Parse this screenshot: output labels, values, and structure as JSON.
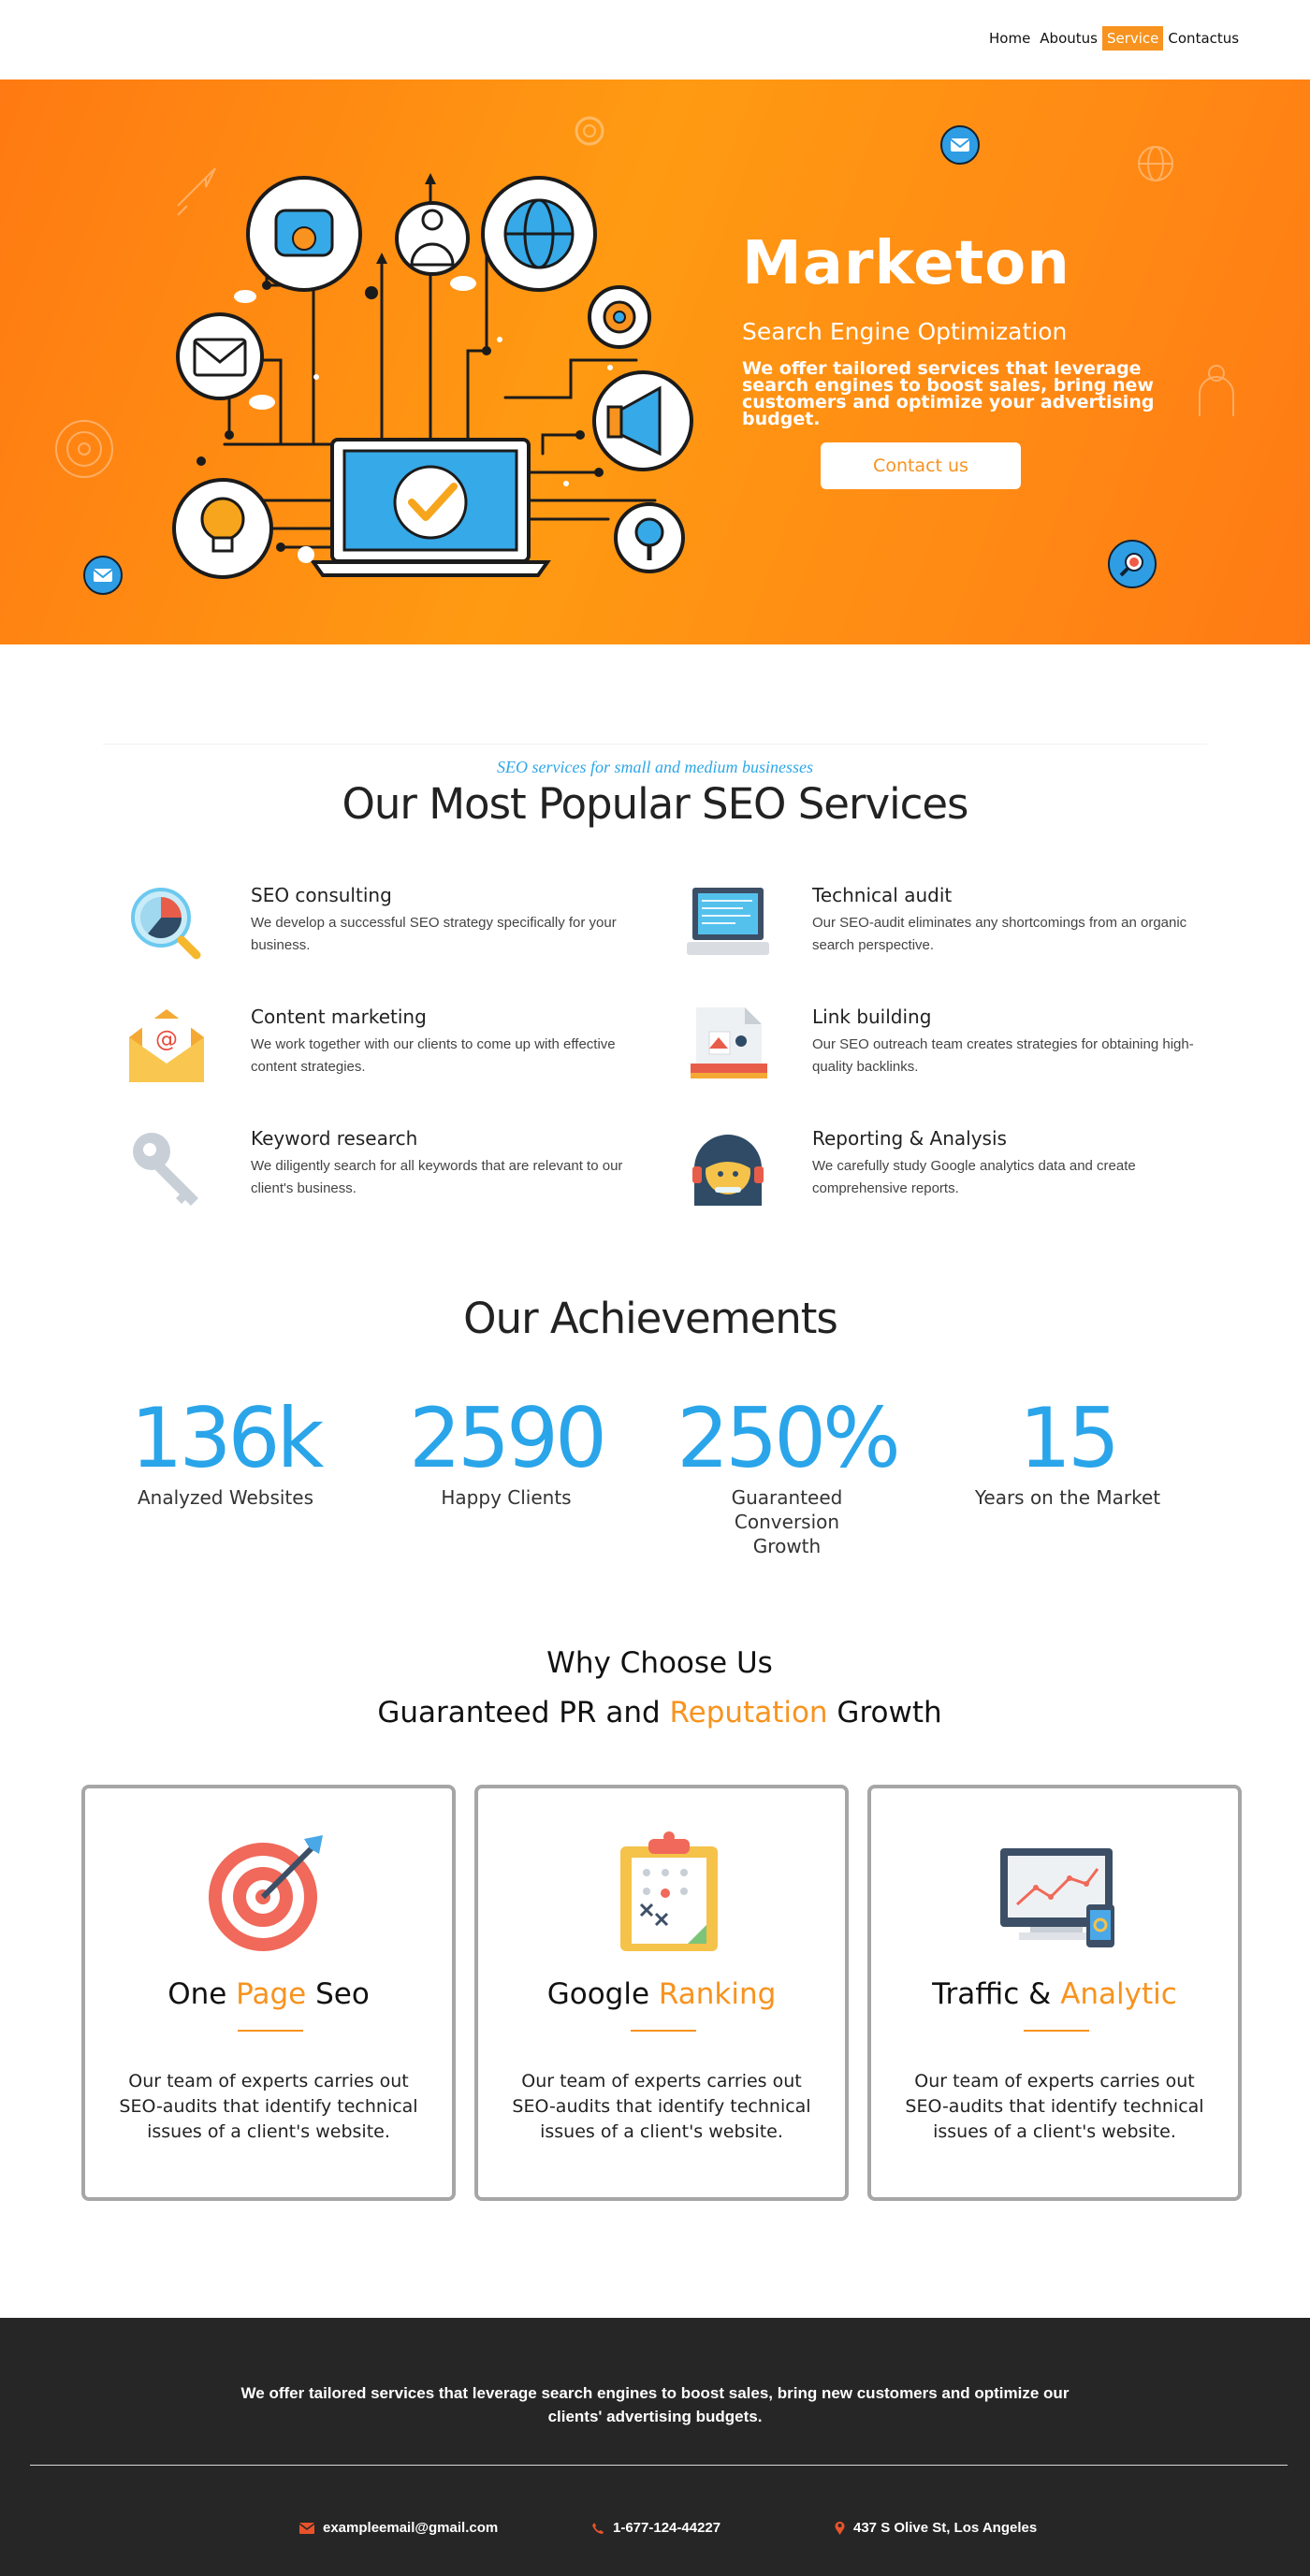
{
  "nav": {
    "items": [
      {
        "label": "Home"
      },
      {
        "label": "Aboutus"
      },
      {
        "label": "Service"
      },
      {
        "label": "Contactus"
      }
    ],
    "active": "Service",
    "accent": "#f7931e"
  },
  "hero": {
    "title": "Marketon",
    "subtitle": "Search Engine Optimization",
    "description": "We offer tailored services that leverage search engines to boost sales, bring new customers and optimize your advertising budget.",
    "button_label": "Contact us",
    "background": "#ff8c14",
    "illustration_icons": [
      "telephone-icon",
      "user-icon",
      "globe-icon",
      "envelope-icon",
      "gear-icon",
      "megaphone-icon",
      "lightbulb-icon",
      "magnifier-icon",
      "laptop-check-icon"
    ]
  },
  "services": {
    "kicker": "SEO services for small and medium businesses",
    "title": "Our Most Popular SEO Services",
    "items": [
      {
        "name": "SEO consulting",
        "text": "We develop a successful SEO strategy specifically for your business.",
        "icon": "chart-magnifier-icon"
      },
      {
        "name": "Technical audit",
        "text": "Our SEO-audit eliminates any shortcomings from an organic search perspective.",
        "icon": "laptop-icon"
      },
      {
        "name": "Content marketing",
        "text": "We work together with our clients to come up with effective content strategies.",
        "icon": "email-envelope-icon"
      },
      {
        "name": "Link building",
        "text": "Our SEO outreach team creates strategies for obtaining high-quality backlinks.",
        "icon": "document-icon"
      },
      {
        "name": "Keyword research",
        "text": "We diligently search for all keywords that are relevant to our client's business.",
        "icon": "key-icon"
      },
      {
        "name": "Reporting & Analysis",
        "text": "We carefully study Google analytics data and create comprehensive reports.",
        "icon": "support-agent-icon"
      }
    ]
  },
  "achievements": {
    "title": "Our Achievements",
    "stats": [
      {
        "value": "136k",
        "label": "Analyzed Websites"
      },
      {
        "value": "2590",
        "label": "Happy Clients"
      },
      {
        "value": "250%",
        "label": "Guaranteed Conversion Growth"
      },
      {
        "value": "15",
        "label": "Years on the Market"
      }
    ],
    "color": "#2aa5ea"
  },
  "why": {
    "title": "Why Choose Us",
    "subtitle_pre": "Guaranteed PR and ",
    "subtitle_highlight": "Reputation",
    "subtitle_post": " Growth",
    "cards": [
      {
        "title_pre": "One ",
        "title_highlight": "Page",
        "title_post": " Seo",
        "text": "Our team of experts carries out SEO-audits that identify technical issues of a client's website.",
        "icon": "target-icon"
      },
      {
        "title_pre": "Google ",
        "title_highlight": "Ranking",
        "title_post": "",
        "text": "Our team of experts carries out SEO-audits that identify technical issues of a client's website.",
        "icon": "clipboard-icon"
      },
      {
        "title_pre": "Traffic & ",
        "title_highlight": "Analytic",
        "title_post": "",
        "text": "Our team of experts carries out SEO-audits that identify technical issues of a client's website.",
        "icon": "monitor-chart-icon"
      }
    ]
  },
  "footer": {
    "text": "We offer tailored services that leverage search engines to boost sales, bring new customers and optimize our clients' advertising budgets.",
    "email": "exampleemail@gmail.com",
    "phone": "1-677-124-44227",
    "address": "437 S Olive St, Los Angeles",
    "icon_color": "#e8532a"
  }
}
